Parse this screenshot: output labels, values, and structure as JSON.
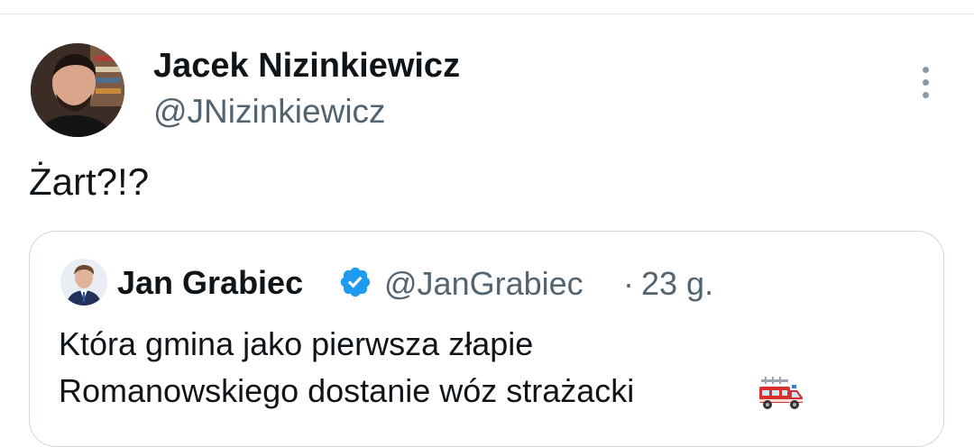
{
  "tweet": {
    "author": {
      "name": "Jacek Nizinkiewicz",
      "handle": "@JNizinkiewicz"
    },
    "text": "Żart?!?",
    "more_icon": "more-vertical-icon"
  },
  "quote": {
    "author": {
      "name": "Jan Grabiec",
      "handle": "@JanGrabiec",
      "verified": true
    },
    "separator": "·",
    "time": "23 g.",
    "lines": [
      "Która gmina jako pierwsza złapie",
      "Romanowskiego dostanie wóz strażacki"
    ],
    "emoji_icon": "fire-engine-icon"
  },
  "colors": {
    "text_primary": "#0f1419",
    "text_secondary": "#536471",
    "verified_blue": "#1d9bf0",
    "border": "#cfd9de"
  }
}
